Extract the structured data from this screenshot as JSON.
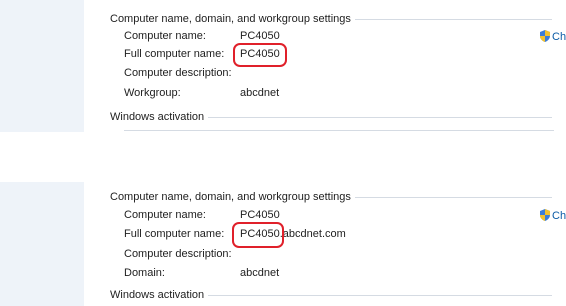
{
  "panels": [
    {
      "group_title": "Computer name, domain, and workgroup settings",
      "change_label": "Cha",
      "rows": [
        {
          "label": "Computer name:",
          "value": "PC4050"
        },
        {
          "label": "Full computer name:",
          "value": "PC4050"
        },
        {
          "label": "Computer description:",
          "value": ""
        },
        {
          "label": "Workgroup:",
          "value": "abcdnet"
        }
      ],
      "next_group_title": "Windows activation"
    },
    {
      "group_title": "Computer name, domain, and workgroup settings",
      "change_label": "Cha",
      "rows": [
        {
          "label": "Computer name:",
          "value": "PC4050"
        },
        {
          "label": "Full computer name:",
          "value": "PC4050.abcdnet.com"
        },
        {
          "label": "Computer description:",
          "value": ""
        },
        {
          "label": "Domain:",
          "value": "abcdnet"
        }
      ],
      "next_group_title": "Windows activation"
    }
  ],
  "colors": {
    "highlight": "#e0202a",
    "link": "#0b5ba6",
    "sidebar": "#eef3f9"
  }
}
